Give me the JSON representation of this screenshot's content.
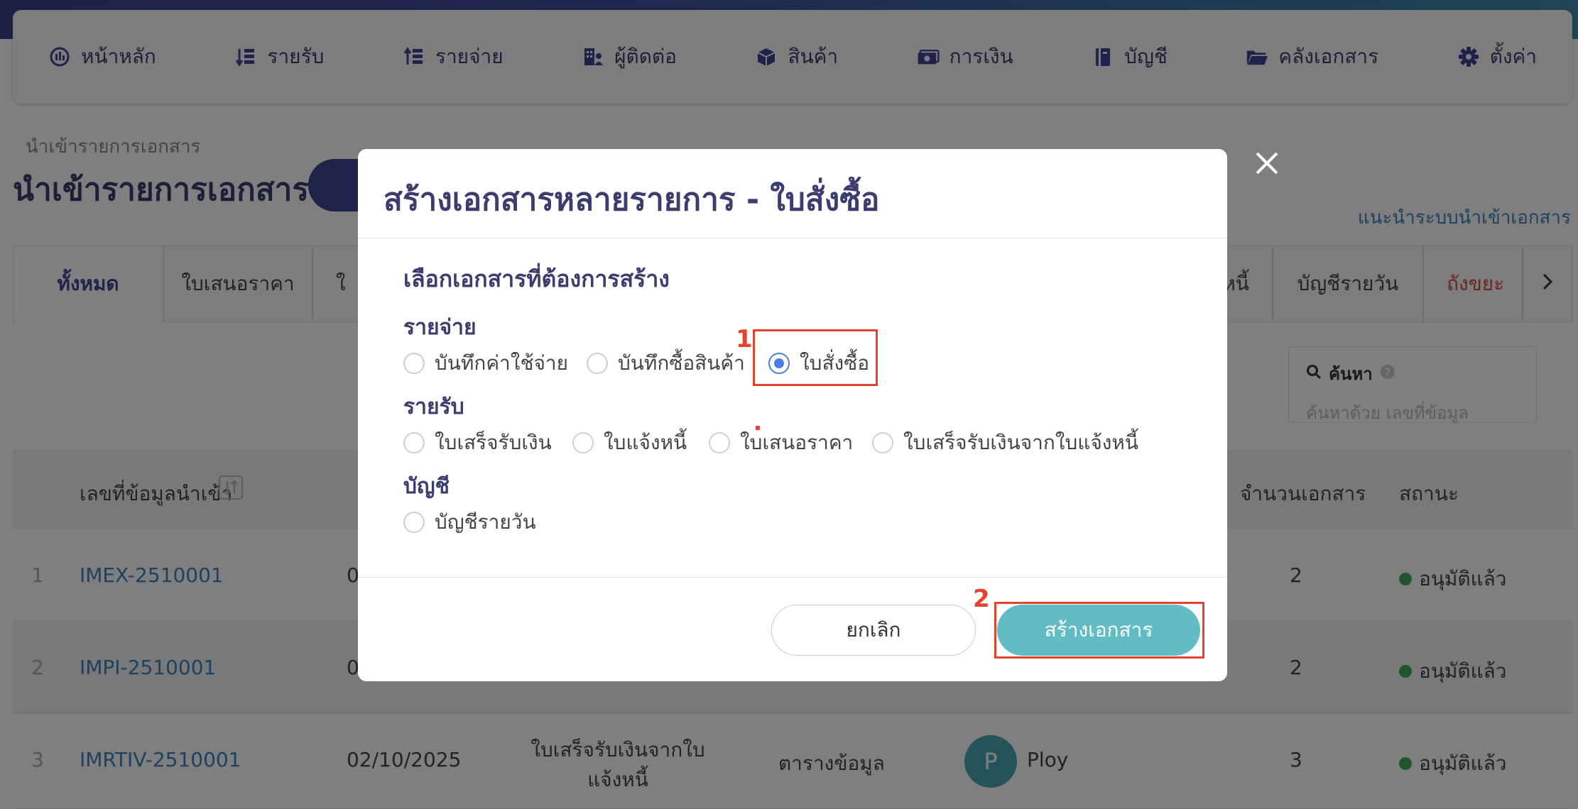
{
  "nav": {
    "items": [
      {
        "label": "หน้าหลัก",
        "icon": "dashboard-icon"
      },
      {
        "label": "รายรับ",
        "icon": "income-icon"
      },
      {
        "label": "รายจ่าย",
        "icon": "expense-icon"
      },
      {
        "label": "ผู้ติดต่อ",
        "icon": "contacts-icon"
      },
      {
        "label": "สินค้า",
        "icon": "product-box-icon"
      },
      {
        "label": "การเงิน",
        "icon": "money-icon"
      },
      {
        "label": "บัญชี",
        "icon": "ledger-icon"
      },
      {
        "label": "คลังเอกสาร",
        "icon": "folder-icon"
      },
      {
        "label": "ตั้งค่า",
        "icon": "gear-icon"
      }
    ]
  },
  "page": {
    "breadcrumb": "นำเข้ารายการเอกสาร",
    "title": "นำเข้ารายการเอกสาร",
    "guide_link": "แนะนำระบบนำเข้าเอกสาร"
  },
  "tabs": [
    {
      "label": "ทั้งหมด",
      "active": true
    },
    {
      "label": "ใบเสนอราคา"
    },
    {
      "label": "ใ"
    },
    {
      "label": "หนี้"
    },
    {
      "label": "บัญชีรายวัน"
    },
    {
      "label": "ถังขยะ"
    }
  ],
  "search": {
    "label": "ค้นหา",
    "placeholder": "ค้นหาด้วย เลขที่ข้อมูล"
  },
  "table": {
    "headers": {
      "import_no": "เลขที่ข้อมูลนำเข้า",
      "doc_count": "จำนวนเอกสาร",
      "status": "สถานะ"
    },
    "rows": [
      {
        "num": "1",
        "id": "IMEX-2510001",
        "date": "0",
        "doc_count": "2",
        "status": "อนุมัติแล้ว"
      },
      {
        "num": "2",
        "id": "IMPI-2510001",
        "date": "0",
        "doc_count": "2",
        "status": "อนุมัติแล้ว"
      },
      {
        "num": "3",
        "id": "IMRTIV-2510001",
        "date": "02/10/2025",
        "doc_type_line1": "ใบเสร็จรับเงินจากใบ",
        "doc_type_line2": "แจ้งหนี้",
        "source": "ตารางข้อมูล",
        "avatar_letter": "P",
        "user": "Ploy",
        "doc_count": "3",
        "status": "อนุมัติแล้ว"
      }
    ]
  },
  "modal": {
    "title": "สร้างเอกสารหลายรายการ - ใบสั่งซื้อ",
    "subtitle": "เลือกเอกสารที่ต้องการสร้าง",
    "sections": {
      "expense": {
        "title": "รายจ่าย",
        "options": [
          "บันทึกค่าใช้จ่าย",
          "บันทึกซื้อสินค้า",
          "ใบสั่งซื้อ"
        ],
        "selected": "ใบสั่งซื้อ"
      },
      "income": {
        "title": "รายรับ",
        "options": [
          "ใบเสร็จรับเงิน",
          "ใบแจ้งหนี้",
          "ใบเสนอราคา",
          "ใบเสร็จรับเงินจากใบแจ้งหนี้"
        ]
      },
      "accounting": {
        "title": "บัญชี",
        "options": [
          "บัญชีรายวัน"
        ]
      }
    },
    "cancel_label": "ยกเลิก",
    "create_label": "สร้างเอกสาร",
    "step1": "1",
    "step2": "2"
  },
  "colors": {
    "brand": "#3f4596",
    "accent_button": "#62bcc6",
    "highlight": "#e5432d",
    "status_ok": "#3cab5a",
    "link": "#3a83c2"
  }
}
